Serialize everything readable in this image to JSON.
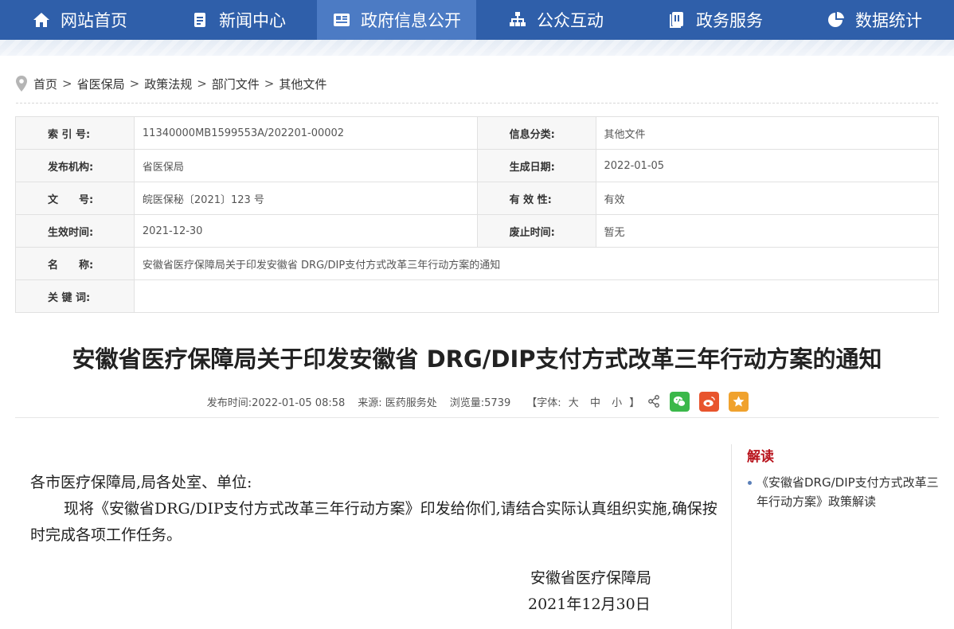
{
  "nav": {
    "items": [
      {
        "label": "网站首页",
        "icon": "home-icon"
      },
      {
        "label": "新闻中心",
        "icon": "document-icon"
      },
      {
        "label": "政府信息公开",
        "icon": "newspaper-icon"
      },
      {
        "label": "公众互动",
        "icon": "org-chart-icon"
      },
      {
        "label": "政务服务",
        "icon": "files-icon"
      },
      {
        "label": "数据统计",
        "icon": "pie-chart-icon"
      }
    ],
    "active_index": 2,
    "color": "#2f5faa",
    "active_color": "#4c7bc4"
  },
  "breadcrumb": {
    "items": [
      "首页",
      "省医保局",
      "政策法规",
      "部门文件",
      "其他文件"
    ],
    "separator": ">"
  },
  "info": {
    "index_label": "索 引 号:",
    "index_value": "11340000MB1599553A/202201-00002",
    "category_label": "信息分类:",
    "category_value": "其他文件",
    "publisher_label": "发布机构:",
    "publisher_value": "省医保局",
    "created_label": "生成日期:",
    "created_value": "2022-01-05",
    "docno_label": "文　　号:",
    "docno_value": "皖医保秘〔2021〕123 号",
    "validity_label": "有 效 性:",
    "validity_value": "有效",
    "effective_label": "生效时间:",
    "effective_value": "2021-12-30",
    "expire_label": "废止时间:",
    "expire_value": "暂无",
    "name_label": "名　　称:",
    "name_value": "安徽省医疗保障局关于印发安徽省 DRG/DIP支付方式改革三年行动方案的通知",
    "keywords_label": "关 键 词:",
    "keywords_value": ""
  },
  "article": {
    "title": "安徽省医疗保障局关于印发安徽省 DRG/DIP支付方式改革三年行动方案的通知",
    "publish_time": "发布时间:2022-01-05 08:58",
    "source": "来源: 医药服务处",
    "views": "浏览量:5739",
    "font_size_open": "【字体:",
    "font_large": "大",
    "font_medium": "中",
    "font_small": "小",
    "font_size_close": "】",
    "share_buttons": [
      {
        "name": "wechat-icon",
        "color": "#3bb84a"
      },
      {
        "name": "weibo-icon",
        "color": "#e8542d"
      },
      {
        "name": "star-icon",
        "color": "#f0a22e"
      }
    ],
    "salutation": "各市医疗保障局,局各处室、单位:",
    "body": "现将《安徽省DRG/DIP支付方式改革三年行动方案》印发给你们,请结合实际认真组织实施,确保按时完成各项工作任务。",
    "signature_org": "安徽省医疗保障局",
    "signature_date": "2021年12月30日"
  },
  "sidebar": {
    "title": "解读",
    "title_color": "#b8121b",
    "items": [
      "《安徽省DRG/DIP支付方式改革三年行动方案》政策解读"
    ]
  }
}
